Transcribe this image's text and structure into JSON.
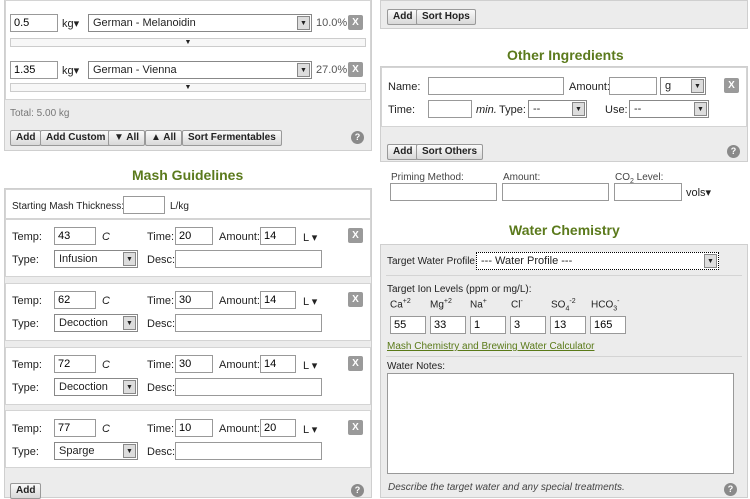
{
  "fermentables": {
    "rows": [
      {
        "amount": "0.5",
        "unit": "kg▾",
        "name": "German - Melanoidin",
        "pct": "10.0%"
      },
      {
        "amount": "1.35",
        "unit": "kg▾",
        "name": "German - Vienna",
        "pct": "27.0%"
      }
    ],
    "total": "Total: 5.00 kg",
    "buttons": {
      "add": "Add",
      "add_custom": "Add Custom",
      "all_down": "▼ All",
      "all_up": "▲ All",
      "sort": "Sort Fermentables"
    },
    "remove": "X",
    "expand": "▼"
  },
  "hops": {
    "buttons": {
      "add": "Add",
      "sort": "Sort Hops"
    }
  },
  "mash": {
    "title": "Mash Guidelines",
    "thickness_label": "Starting Mash Thickness:",
    "thickness_value": "",
    "thickness_unit": "L/kg",
    "labels": {
      "temp": "Temp:",
      "time": "Time:",
      "amount": "Amount:",
      "type": "Type:",
      "desc": "Desc:"
    },
    "steps": [
      {
        "temp": "43",
        "temp_unit": "C",
        "time": "20",
        "amount": "14",
        "amount_unit": "L ▾",
        "type": "Infusion",
        "desc": ""
      },
      {
        "temp": "62",
        "temp_unit": "C",
        "time": "30",
        "amount": "14",
        "amount_unit": "L ▾",
        "type": "Decoction",
        "desc": ""
      },
      {
        "temp": "72",
        "temp_unit": "C",
        "time": "30",
        "amount": "14",
        "amount_unit": "L ▾",
        "type": "Decoction",
        "desc": ""
      },
      {
        "temp": "77",
        "temp_unit": "C",
        "time": "10",
        "amount": "20",
        "amount_unit": "L ▾",
        "type": "Sparge",
        "desc": ""
      }
    ],
    "add": "Add",
    "remove": "X"
  },
  "other": {
    "title": "Other Ingredients",
    "labels": {
      "name": "Name:",
      "amount": "Amount:",
      "time": "Time:",
      "min": "min.",
      "type": "Type:",
      "use": "Use:"
    },
    "unit": "g",
    "type_value": "--",
    "use_value": "--",
    "buttons": {
      "add": "Add",
      "sort": "Sort Others"
    },
    "remove": "X",
    "priming_method": "Priming Method:",
    "priming_amount": "Amount:",
    "co2_prefix": "CO",
    "co2_sub": "2",
    "co2_suffix": " Level:",
    "vols": "vols▾"
  },
  "water": {
    "title": "Water Chemistry",
    "target_label": "Target Water Profile:",
    "target_value": "--- Water Profile ---",
    "ion_label": "Target Ion Levels (ppm or mg/L):",
    "ions": [
      {
        "base": "Ca",
        "sub": "",
        "sup": "+2",
        "value": "55"
      },
      {
        "base": "Mg",
        "sub": "",
        "sup": "+2",
        "value": "33"
      },
      {
        "base": "Na",
        "sub": "",
        "sup": "+",
        "value": "1"
      },
      {
        "base": "Cl",
        "sub": "",
        "sup": "-",
        "value": "3"
      },
      {
        "base": "SO",
        "sub": "4",
        "sup": "-2",
        "value": "13"
      },
      {
        "base": "HCO",
        "sub": "3",
        "sup": "-",
        "value": "165"
      }
    ],
    "link": "Mash Chemistry and Brewing Water Calculator",
    "notes_label": "Water Notes:",
    "notes_hint": "Describe the target water and any special treatments."
  },
  "help": "?"
}
